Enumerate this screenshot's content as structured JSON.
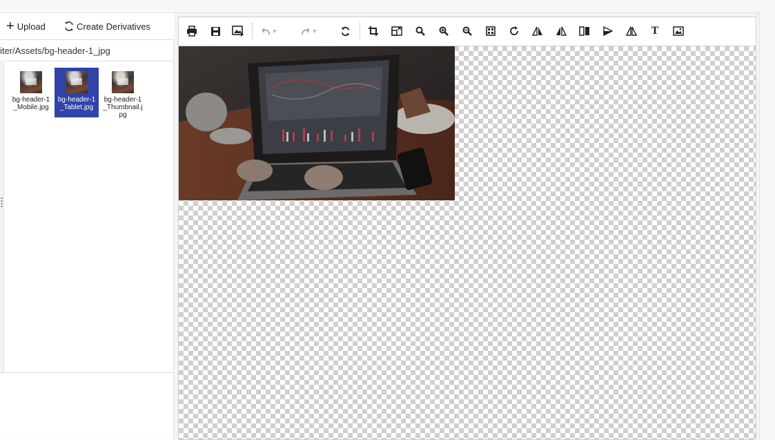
{
  "toolbar": {
    "upload_label": "Upload",
    "create_derivatives_label": "Create Derivatives"
  },
  "path": "iter/Assets/bg-header-1_jpg",
  "files": [
    {
      "name": "bg-header-1_Mobile.jpg",
      "selected": false
    },
    {
      "name": "bg-header-1_Tablet.jpg",
      "selected": true
    },
    {
      "name": "bg-header-1_Thumbnail.jpg",
      "selected": false
    }
  ],
  "editor_tools": [
    "print-icon",
    "save-icon",
    "save-as-icon",
    "undo-icon",
    "redo-icon",
    "reset-icon",
    "crop-icon",
    "resize-icon",
    "zoom-icon",
    "zoom-in-icon",
    "zoom-out-icon",
    "zoom-fit-icon",
    "rotate-icon",
    "flip-horizontal-icon",
    "flip-vertical-icon",
    "mirror-icon",
    "flip-icon",
    "mirror-vertical-icon",
    "text-icon",
    "insert-image-icon"
  ],
  "text_tool_glyph": "T",
  "colors": {
    "selected_tile": "#2f43a9",
    "canvas_checker": "#cfcfcf"
  }
}
